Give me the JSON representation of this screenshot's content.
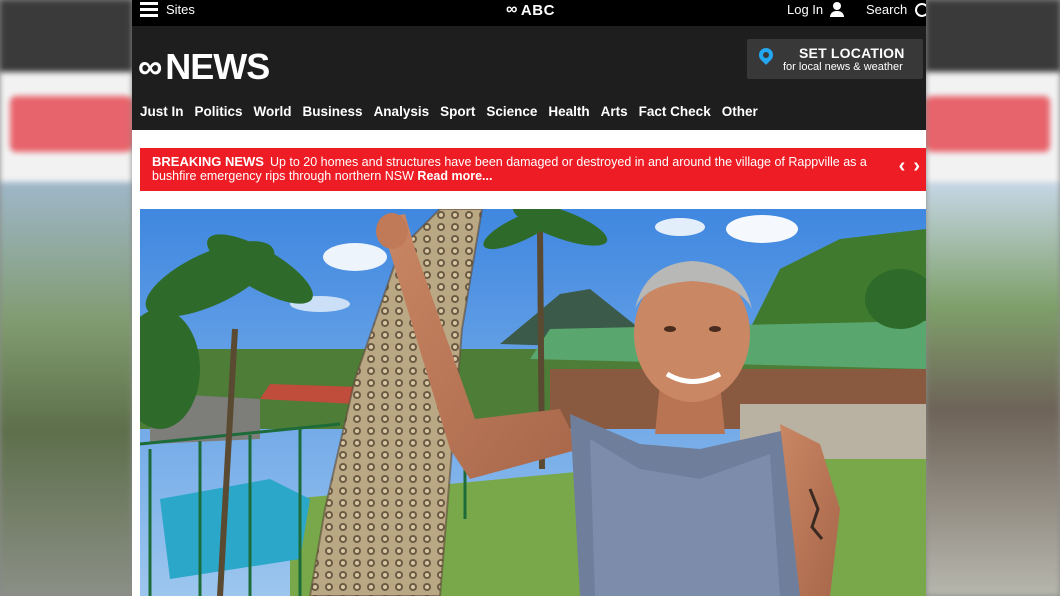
{
  "topbar": {
    "sites_label": "Sites",
    "brand_label": "ABC",
    "login_label": "Log In",
    "search_label": "Search"
  },
  "header": {
    "brand_word": "NEWS",
    "location": {
      "title": "SET LOCATION",
      "subtitle": "for local news & weather"
    }
  },
  "nav": {
    "items": [
      "Just In",
      "Politics",
      "World",
      "Business",
      "Analysis",
      "Sport",
      "Science",
      "Health",
      "Arts",
      "Fact Check",
      "Other"
    ]
  },
  "breaking": {
    "label": "BREAKING NEWS",
    "text": "Up to 20 homes and structures have been damaged or destroyed in and around the village of Rappville as a bushfire emergency rips through northern NSW",
    "read_more": "Read more...",
    "prev_glyph": "‹",
    "next_glyph": "›"
  },
  "icons": {
    "menu": "hamburger-icon",
    "user": "user-icon",
    "search": "search-icon",
    "location": "location-pin-icon"
  },
  "colors": {
    "topbar": "#000000",
    "header": "#1e1e1e",
    "breaking": "#ee1c25",
    "pin": "#22a7f0"
  }
}
